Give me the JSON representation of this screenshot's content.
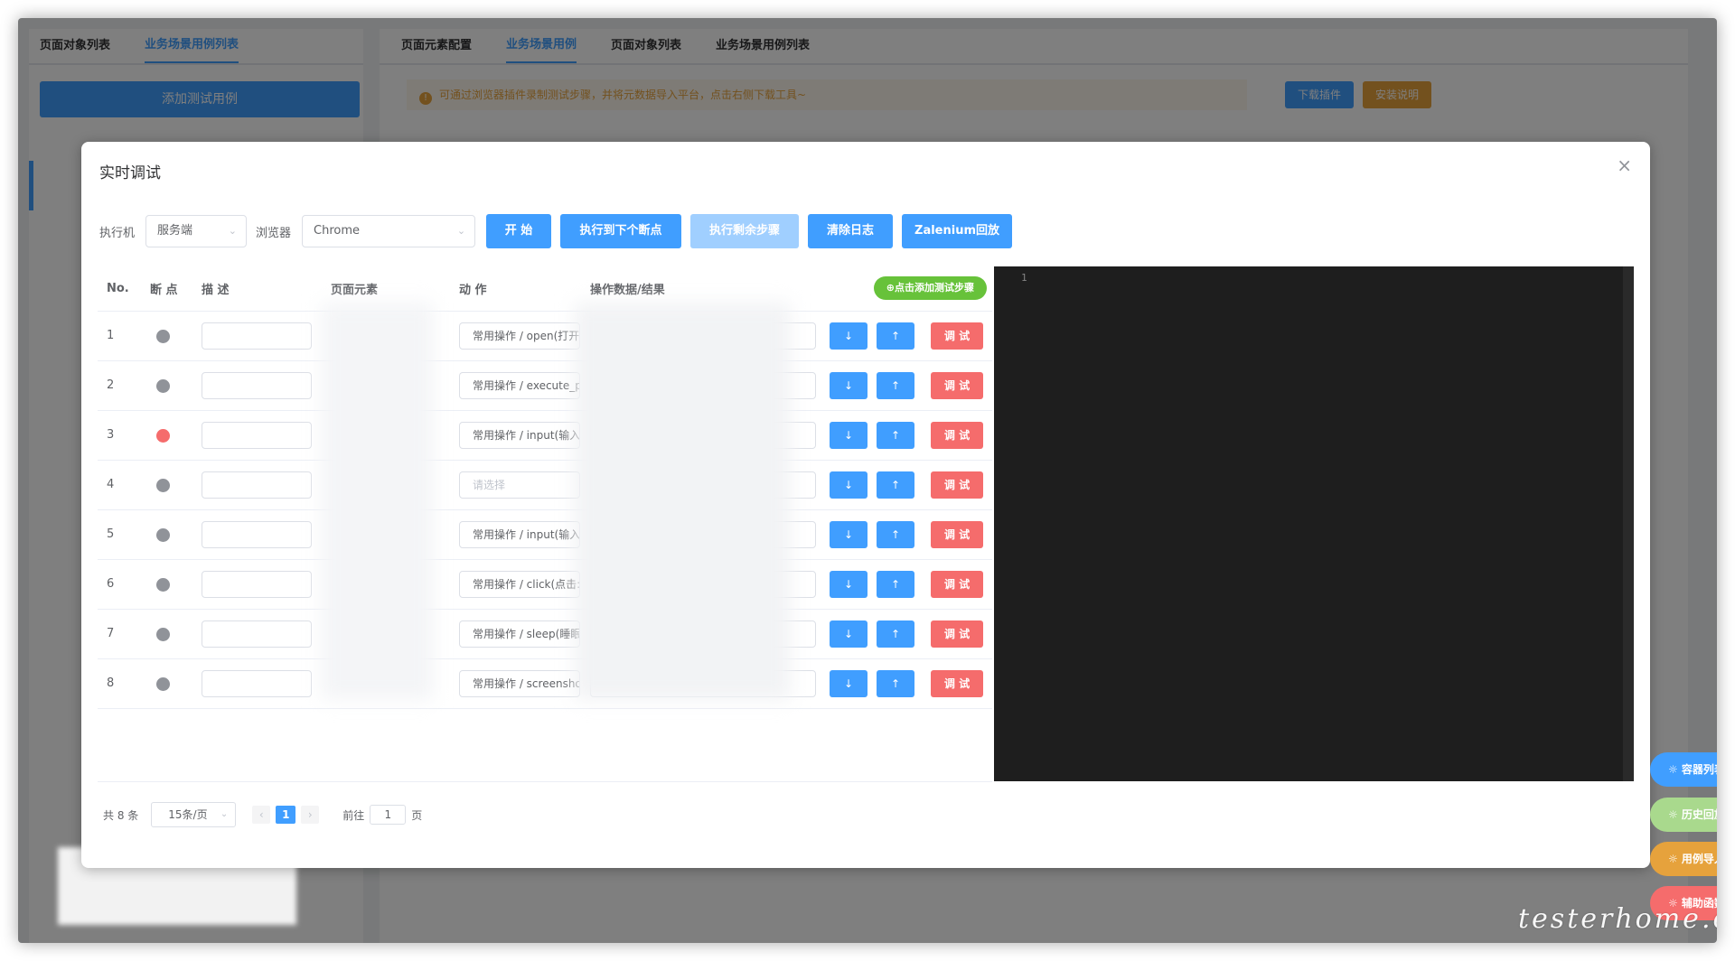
{
  "left_panel": {
    "tabs": [
      "页面对象列表",
      "业务场景用例列表"
    ],
    "add_case_button": "添加测试用例"
  },
  "right_panel": {
    "tabs": [
      "页面元素配置",
      "业务场景用例",
      "页面对象列表",
      "业务场景用例列表"
    ],
    "tip": "可通过浏览器插件录制测试步骤，并将元数据导入平台，点击右侧下载工具~",
    "download_plugin": "下载插件",
    "install_guide": "安装说明"
  },
  "dialog": {
    "title": "实时调试",
    "close_icon": "×",
    "executor_label": "执行机",
    "executor_value": "服务端",
    "browser_label": "浏览器",
    "browser_value": "Chrome",
    "buttons": {
      "start": "开 始",
      "run_to_breakpoint": "执行到下个断点",
      "run_remaining": "执行剩余步骤",
      "clear_log": "清除日志",
      "zalenium": "Zalenium回放"
    },
    "columns": {
      "no": "No.",
      "breakpoint": "断 点",
      "desc": "描 述",
      "element": "页面元素",
      "action": "动 作",
      "data": "操作数据/结果"
    },
    "add_step": "⊕点击添加测试步骤",
    "rows": [
      {
        "no": "1",
        "action": "常用操作 / open(打开l",
        "bp": false
      },
      {
        "no": "2",
        "action": "常用操作 / execute_p",
        "bp": false
      },
      {
        "no": "3",
        "action": "常用操作 / input(输入:",
        "bp": true
      },
      {
        "no": "4",
        "action": "请选择",
        "bp": false,
        "placeholder": true
      },
      {
        "no": "5",
        "action": "常用操作 / input(输入:",
        "bp": false
      },
      {
        "no": "6",
        "action": "常用操作 / click(点击:",
        "bp": false
      },
      {
        "no": "7",
        "action": "常用操作 / sleep(睡眠",
        "bp": false
      },
      {
        "no": "8",
        "action": "常用操作 / screensho",
        "bp": false
      }
    ],
    "down_arrow": "↓",
    "up_arrow": "↑",
    "debug_label": "调 试",
    "editor_line": "1",
    "pagination": {
      "total": "共 8 条",
      "page_size": "15条/页",
      "current": "1",
      "goto_label": "前往",
      "goto_value": "1",
      "page_suffix": "页"
    }
  },
  "float_buttons": [
    "☼ 容器列表",
    "☼ 历史回放",
    "☼ 用例导入",
    "☼ 辅助函数"
  ],
  "watermark": "testerhome.com",
  "colors": {
    "primary": "#409eff",
    "danger": "#f56c6c",
    "success": "#67c23a",
    "warning": "#e6a23c"
  }
}
